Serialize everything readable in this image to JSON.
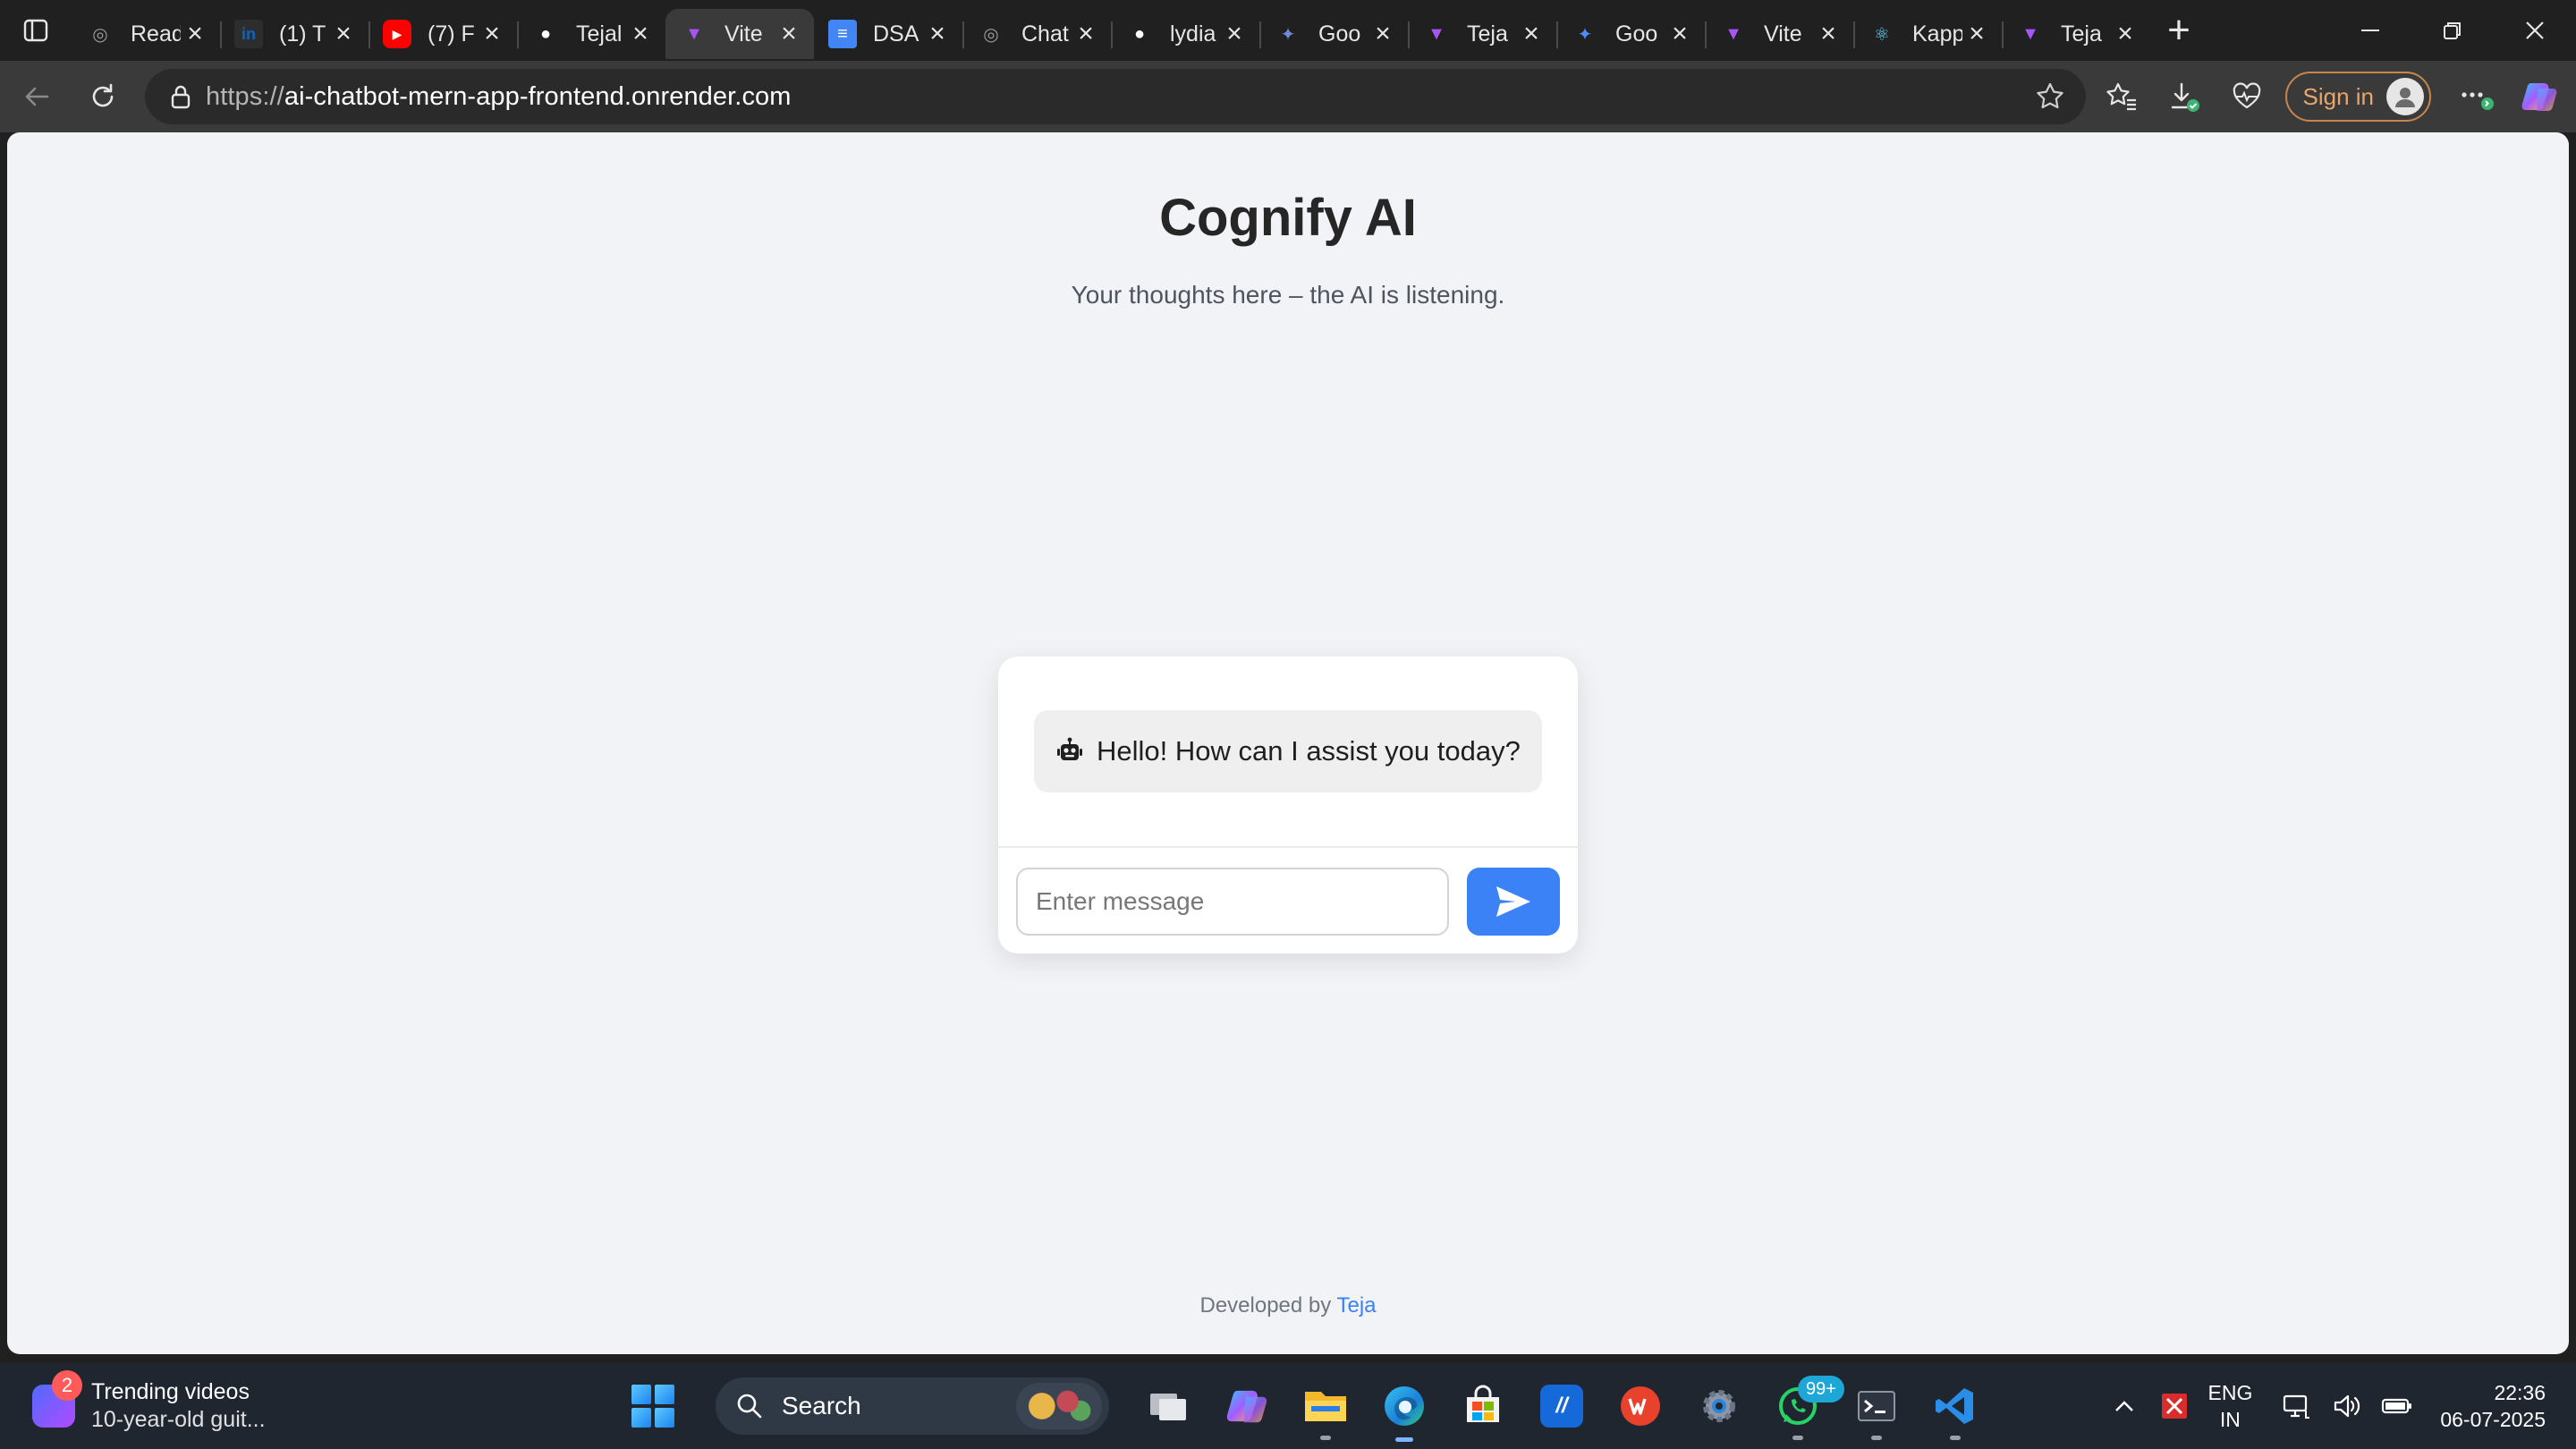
{
  "browser": {
    "tabs": [
      {
        "title": "Read",
        "favicon": "openai-icon",
        "color": "#9a9a9a"
      },
      {
        "title": "(1) T",
        "favicon": "linkedin-icon",
        "color": "#0a66c2"
      },
      {
        "title": "(7) F",
        "favicon": "youtube-icon",
        "color": "#ff0000"
      },
      {
        "title": "Tejal",
        "favicon": "github-icon",
        "color": "#ffffff"
      },
      {
        "title": "Vite",
        "favicon": "vite-icon",
        "color": "#a855f7",
        "active": true
      },
      {
        "title": "DSA",
        "favicon": "docs-icon",
        "color": "#4285f4"
      },
      {
        "title": "Chat",
        "favicon": "openai-icon",
        "color": "#9a9a9a"
      },
      {
        "title": "lydia",
        "favicon": "github-icon",
        "color": "#ffffff"
      },
      {
        "title": "Goo",
        "favicon": "gemini-icon",
        "color": "#6f8bd8"
      },
      {
        "title": "Teja",
        "favicon": "vite-icon",
        "color": "#a855f7"
      },
      {
        "title": "Goo",
        "favicon": "gemini-icon",
        "color": "#4c8df6"
      },
      {
        "title": "Vite",
        "favicon": "vite-icon",
        "color": "#a855f7"
      },
      {
        "title": "Kapp",
        "favicon": "react-icon",
        "color": "#61dafb"
      },
      {
        "title": "Teja",
        "favicon": "vite-icon",
        "color": "#a855f7"
      }
    ],
    "url_protocol": "https://",
    "url_host": "ai-chatbot-mern-app-frontend.onrender.com",
    "signin_label": "Sign in"
  },
  "page": {
    "title": "Cognify AI",
    "subtitle": "Your thoughts here – the AI is listening.",
    "bot_message": "Hello! How can I assist you today?",
    "input_placeholder": "Enter message",
    "footer_prefix": "Developed by",
    "footer_author": "Teja",
    "accent_color": "#3b82f6"
  },
  "taskbar": {
    "widget_badge": "2",
    "widget_title": "Trending videos",
    "widget_subtitle": "10-year-old guit...",
    "search_label": "Search",
    "whatsapp_badge": "99+",
    "lang_primary": "ENG",
    "lang_secondary": "IN",
    "time": "22:36",
    "date": "06-07-2025"
  }
}
